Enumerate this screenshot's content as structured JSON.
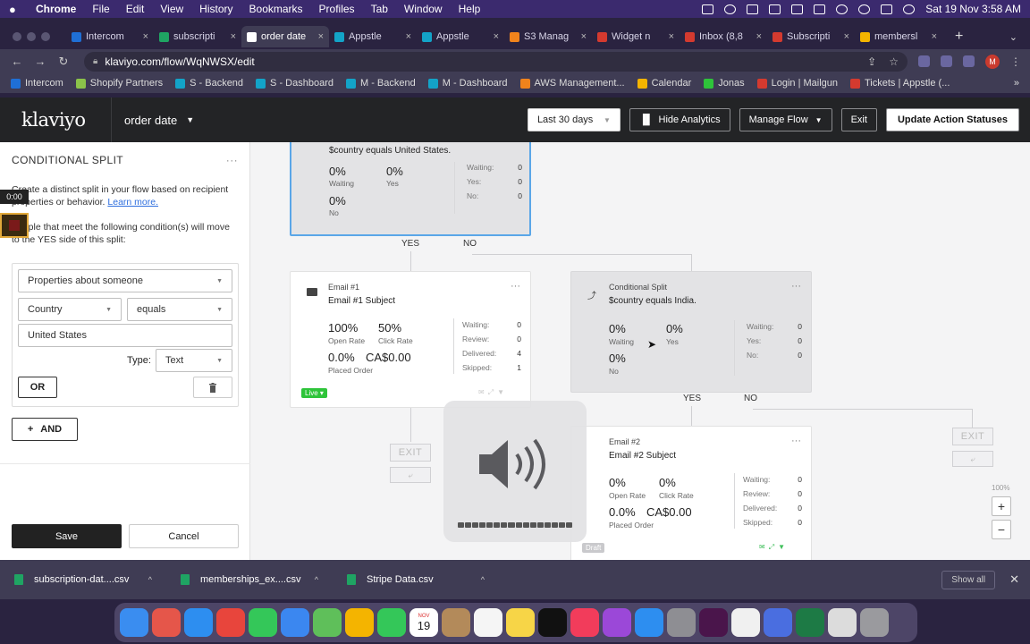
{
  "menubar": {
    "app": "Chrome",
    "items": [
      "File",
      "Edit",
      "View",
      "History",
      "Bookmarks",
      "Profiles",
      "Tab",
      "Window",
      "Help"
    ],
    "clock": "Sat 19 Nov  3:58 AM"
  },
  "tabs": [
    {
      "label": "Intercom",
      "color": "#1f6fd6"
    },
    {
      "label": "subscripti",
      "color": "#1fa463"
    },
    {
      "label": "order date",
      "color": "#ffffff",
      "active": true
    },
    {
      "label": "Appstle",
      "color": "#13a3c8"
    },
    {
      "label": "Appstle",
      "color": "#13a3c8"
    },
    {
      "label": "S3 Manag",
      "color": "#f0831c"
    },
    {
      "label": "Widget n",
      "color": "#d43a2f"
    },
    {
      "label": "Inbox (8,8",
      "color": "#d43a2f"
    },
    {
      "label": "Subscripti",
      "color": "#d43a2f"
    },
    {
      "label": "membersl",
      "color": "#f4b400"
    }
  ],
  "address": {
    "url": "klaviyo.com/flow/WqNWSX/edit"
  },
  "bookmarks": [
    {
      "label": "Intercom",
      "color": "#1f6fd6"
    },
    {
      "label": "Shopify Partners",
      "color": "#8bc34a"
    },
    {
      "label": "S - Backend",
      "color": "#13a3c8"
    },
    {
      "label": "S - Dashboard",
      "color": "#13a3c8"
    },
    {
      "label": "M - Backend",
      "color": "#13a3c8"
    },
    {
      "label": "M - Dashboard",
      "color": "#13a3c8"
    },
    {
      "label": "AWS Management...",
      "color": "#f0831c"
    },
    {
      "label": "Calendar",
      "color": "#f4b400"
    },
    {
      "label": "Jonas",
      "color": "#2ec43a"
    },
    {
      "label": "Login | Mailgun",
      "color": "#d43a2f"
    },
    {
      "label": "Tickets | Appstle (...",
      "color": "#d43a2f"
    }
  ],
  "header": {
    "logo": "klaviyo",
    "flow_name": "order date",
    "date_range": "Last 30 days",
    "hide_analytics": "Hide Analytics",
    "manage_flow": "Manage Flow",
    "exit": "Exit",
    "update": "Update Action Statuses"
  },
  "sidebar": {
    "title": "CONDITIONAL SPLIT",
    "desc": "Create a distinct split in your flow based on recipient properties or behavior.",
    "learn_more": "Learn more.",
    "desc2": "People that meet the following condition(s) will move to the YES side of this split:",
    "dim_select": "Properties about someone",
    "property_select": "Country",
    "operator_select": "equals",
    "value_input": "United States",
    "type_label": "Type:",
    "type_select": "Text",
    "or_label": "OR",
    "and_label": "AND",
    "save": "Save",
    "cancel": "Cancel",
    "recording_time": "0:00"
  },
  "canvas": {
    "split1": {
      "condition": "$country equals United States.",
      "yes_pct": "0%",
      "yes_label": "Yes",
      "waiting_pct": "0%",
      "waiting_label": "Waiting",
      "no_pct": "0%",
      "no_label": "No",
      "stats": [
        {
          "label": "Waiting:",
          "value": "0"
        },
        {
          "label": "Yes:",
          "value": "0"
        },
        {
          "label": "No:",
          "value": "0"
        }
      ]
    },
    "branch_yes": "YES",
    "branch_no": "NO",
    "email1": {
      "label": "Email #1",
      "subject": "Email #1 Subject",
      "open_pct": "100%",
      "open_label": "Open Rate",
      "click_pct": "50%",
      "click_label": "Click Rate",
      "placed_pct": "0.0%",
      "placed_value": "CA$0.00",
      "placed_label": "Placed Order",
      "stats": [
        {
          "label": "Waiting:",
          "value": "0"
        },
        {
          "label": "Review:",
          "value": "0"
        },
        {
          "label": "Delivered:",
          "value": "4"
        },
        {
          "label": "Skipped:",
          "value": "1"
        }
      ],
      "badge": "Live"
    },
    "split2": {
      "label": "Conditional Split",
      "condition": "$country equals India.",
      "waiting_pct": "0%",
      "waiting_label": "Waiting",
      "yes_pct": "0%",
      "yes_label": "Yes",
      "no_pct": "0%",
      "no_label": "No",
      "stats": [
        {
          "label": "Waiting:",
          "value": "0"
        },
        {
          "label": "Yes:",
          "value": "0"
        },
        {
          "label": "No:",
          "value": "0"
        }
      ]
    },
    "email2": {
      "label": "Email #2",
      "subject": "Email #2 Subject",
      "open_pct": "0%",
      "open_label": "Open Rate",
      "click_pct": "0%",
      "click_label": "Click Rate",
      "placed_pct": "0.0%",
      "placed_value": "CA$0.00",
      "placed_label": "Placed Order",
      "stats": [
        {
          "label": "Waiting:",
          "value": "0"
        },
        {
          "label": "Review:",
          "value": "0"
        },
        {
          "label": "Delivered:",
          "value": "0"
        },
        {
          "label": "Skipped:",
          "value": "0"
        }
      ],
      "badge": "Draft"
    },
    "exit_label": "EXIT",
    "zoom": "100%",
    "zoom_in": "+",
    "zoom_out": "−"
  },
  "volume": {
    "level": 1.0
  },
  "downloads": {
    "files": [
      "subscription-dat....csv",
      "memberships_ex....csv",
      "Stripe Data.csv"
    ],
    "show_all": "Show all"
  },
  "dock": {
    "apps": [
      {
        "name": "finder",
        "color": "#3a8df0"
      },
      {
        "name": "launchpad",
        "color": "#e5564a"
      },
      {
        "name": "safari",
        "color": "#2d8ef0"
      },
      {
        "name": "chrome",
        "color": "#e8453c"
      },
      {
        "name": "messages",
        "color": "#34c759"
      },
      {
        "name": "mail",
        "color": "#3b87f0"
      },
      {
        "name": "maps",
        "color": "#5fbf5a"
      },
      {
        "name": "photos",
        "color": "#f4b400"
      },
      {
        "name": "facetime",
        "color": "#34c759"
      },
      {
        "name": "calendar",
        "color": "#ffffff"
      },
      {
        "name": "contacts",
        "color": "#b38a5a"
      },
      {
        "name": "reminders",
        "color": "#f5f5f5"
      },
      {
        "name": "notes",
        "color": "#f7d547"
      },
      {
        "name": "tv",
        "color": "#111111"
      },
      {
        "name": "music",
        "color": "#f23c5b"
      },
      {
        "name": "podcasts",
        "color": "#9b48d8"
      },
      {
        "name": "app-store",
        "color": "#2d8ef0"
      },
      {
        "name": "system-preferences",
        "color": "#8e8e93"
      },
      {
        "name": "slack",
        "color": "#4a154b"
      },
      {
        "name": "textedit",
        "color": "#f0f0f0"
      },
      {
        "name": "jira-tool",
        "color": "#4a6ee0"
      },
      {
        "name": "excel",
        "color": "#1d7a45"
      },
      {
        "name": "files",
        "color": "#dcdcdc"
      },
      {
        "name": "trash",
        "color": "#9a9a9e"
      }
    ],
    "calendar_month": "NOV",
    "calendar_day": "19"
  }
}
